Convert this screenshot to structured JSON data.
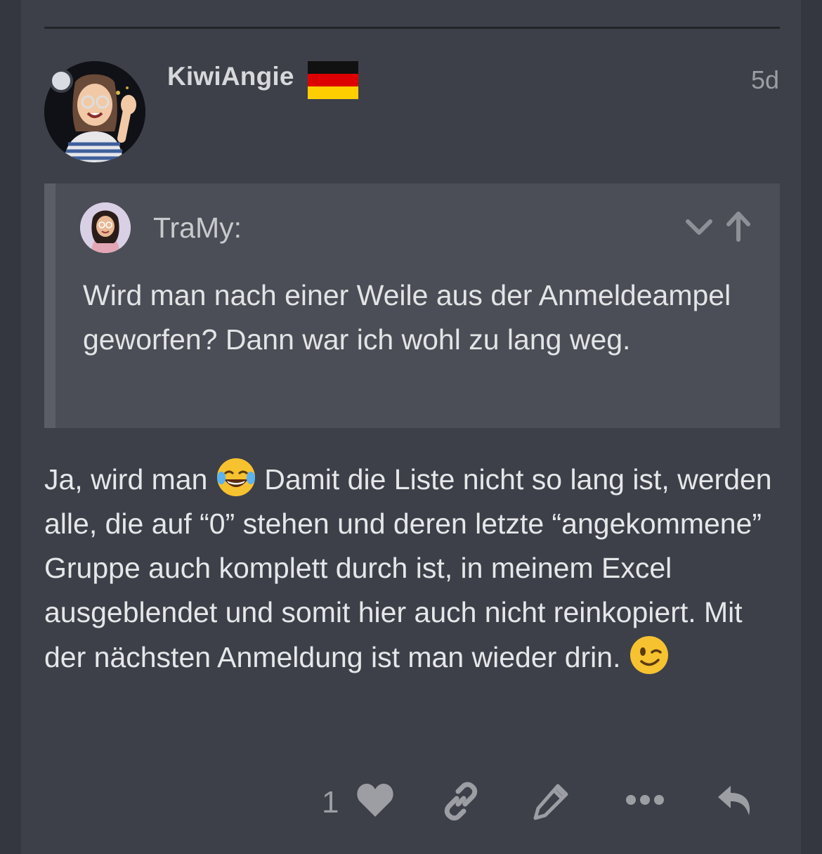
{
  "post": {
    "username": "KiwiAngie",
    "flag_emoji": "germany-flag",
    "timestamp": "5d",
    "body_parts": [
      "Ja, wird man ",
      " Damit die Liste nicht so lang ist, werden alle, die auf “0” stehen und deren letzte “angekommene” Gruppe auch komplett durch ist, in meinem Excel ausgeblendet und somit hier auch nicht reinkopiert. Mit der nächsten Anmeldung ist man wieder drin. "
    ],
    "emojis": [
      "face-with-tears-of-joy",
      "winking-face"
    ]
  },
  "quote": {
    "author": "TraMy:",
    "text": "Wird man nach einer Weile aus der Anmeldeampel geworfen? Dann war ich wohl zu lang weg."
  },
  "actions": {
    "like_count": "1",
    "icons": [
      "heart-icon",
      "link-icon",
      "pencil-icon",
      "more-icon",
      "reply-icon"
    ]
  },
  "colors": {
    "background": "#3d4049",
    "quote_bg": "#4b4e56",
    "text": "#e6e7e9",
    "muted": "#9c9ea4"
  }
}
